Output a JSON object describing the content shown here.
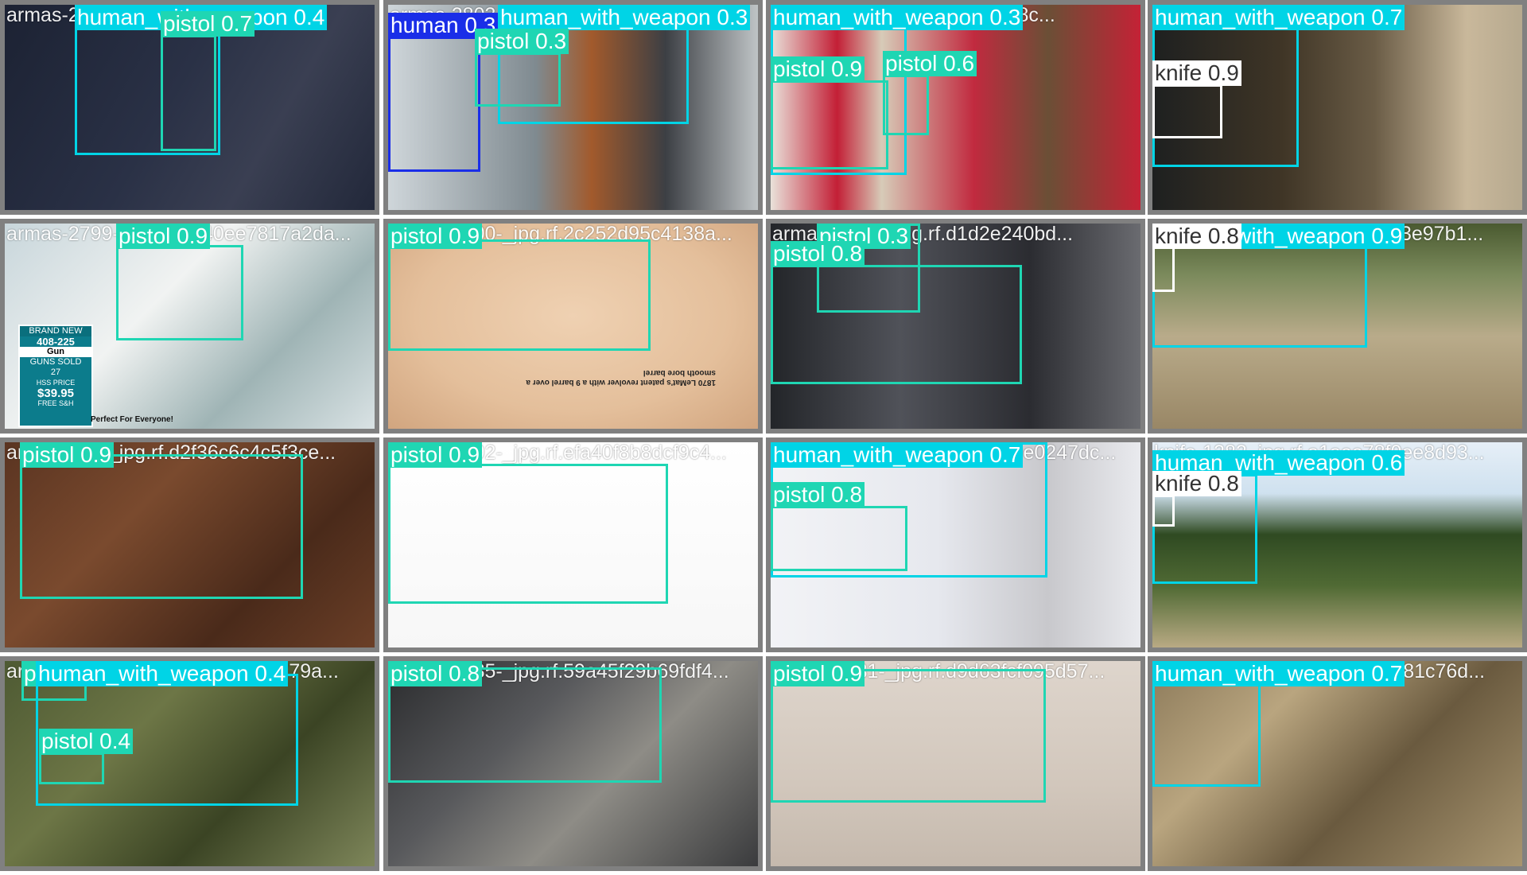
{
  "colors": {
    "human_with_weapon": "#00d4e6",
    "pistol": "#1fd6b3",
    "human": "#1a2ee8",
    "knife": "#ffffff",
    "knife_text": "#333333"
  },
  "tiles": [
    {
      "filename": "armas-2791-_jpg.rf.5751415b30a...",
      "detections": [
        {
          "class": "human_with_weapon",
          "score": "0.4"
        },
        {
          "class": "pistol",
          "score": "0.7"
        }
      ]
    },
    {
      "filename": "armas-2803-_jpg.rf.2f8d2a...",
      "detections": [
        {
          "class": "human_with_weapon",
          "score": "0.3"
        },
        {
          "class": "human",
          "score": "0.3"
        },
        {
          "class": "pistol",
          "score": "0.3"
        }
      ]
    },
    {
      "filename": "armas-2105-_jpg.rf.a6d2a3f8c...",
      "detections": [
        {
          "class": "human_with_weapon",
          "score": "0.3"
        },
        {
          "class": "pistol",
          "score": "0.9"
        },
        {
          "class": "pistol",
          "score": "0.6"
        }
      ]
    },
    {
      "filename": "knife-1071_jpg.rf.70d1bd2...",
      "detections": [
        {
          "class": "human_with_weapon",
          "score": "0.7"
        },
        {
          "class": "knife",
          "score": "0.9"
        }
      ]
    },
    {
      "filename": "armas-2799-_jpg.rf.6b40ee7817a2da...",
      "detections": [
        {
          "class": "pistol",
          "score": "0.9"
        }
      ]
    },
    {
      "filename": "armas-2500-_jpg.rf.2c252d95c4138a...",
      "detections": [
        {
          "class": "pistol",
          "score": "0.9"
        }
      ]
    },
    {
      "filename": "armas-2823-_jpg.rf.d1d2e240bd...",
      "detections": [
        {
          "class": "pistol",
          "score": "0.3"
        },
        {
          "class": "pistol",
          "score": "0.8"
        }
      ]
    },
    {
      "filename": "knife-1289_jpg.rf.6bc17df453e97b1...",
      "detections": [
        {
          "class": "human_with_weapon",
          "score": "0.9"
        },
        {
          "class": "knife",
          "score": "0.8"
        }
      ]
    },
    {
      "filename": "armas-777-_jpg.rf.d2f36c6c4c5f3ce...",
      "detections": [
        {
          "class": "pistol",
          "score": "0.9"
        }
      ]
    },
    {
      "filename": "armas-2792-_jpg.rf.efa40f8b8dcf9c4...",
      "detections": [
        {
          "class": "pistol",
          "score": "0.9"
        }
      ]
    },
    {
      "filename": "armas-724-_jpg.rf.e1479bd9e0247dc...",
      "detections": [
        {
          "class": "human_with_weapon",
          "score": "0.7"
        },
        {
          "class": "pistol",
          "score": "0.8"
        }
      ]
    },
    {
      "filename": "knife-1282_jpg.rf.a1aee78f0ee8d93...",
      "detections": [
        {
          "class": "human_with_weapon",
          "score": "0.6"
        },
        {
          "class": "knife",
          "score": "0.8"
        }
      ]
    },
    {
      "filename": "armas-797-_jpg.rf.dde11a476a779a...",
      "detections": [
        {
          "class": "pistol",
          "score": "0.9"
        },
        {
          "class": "human_with_weapon",
          "score": "0.4"
        },
        {
          "class": "pistol",
          "score": "0.4"
        }
      ]
    },
    {
      "filename": "armas-1085-_jpg.rf.59a45f29b69fdf4...",
      "detections": [
        {
          "class": "pistol",
          "score": "0.8"
        }
      ]
    },
    {
      "filename": "armas-1631-_jpg.rf.d9d63fcf095d57...",
      "detections": [
        {
          "class": "pistol",
          "score": "0.9"
        }
      ]
    },
    {
      "filename": "knife-1113_jpg.rf.dab2a55bc81c76d...",
      "detections": [
        {
          "class": "human_with_weapon",
          "score": "0.7"
        }
      ]
    }
  ],
  "sign_overlay": {
    "brand": "BRAND NEW",
    "item_code": "408-225",
    "item": "Gun",
    "sold_label": "GUNS SOLD",
    "sold_count": "27",
    "price_label": "HSS PRICE",
    "price": "$39.95",
    "shipping": "FREE S&H",
    "tagline": "Perfect For Everyone!"
  },
  "caption_overlay": "1870 LeMat's patent revolver with a 9 barrel over a smooth bore barrel"
}
